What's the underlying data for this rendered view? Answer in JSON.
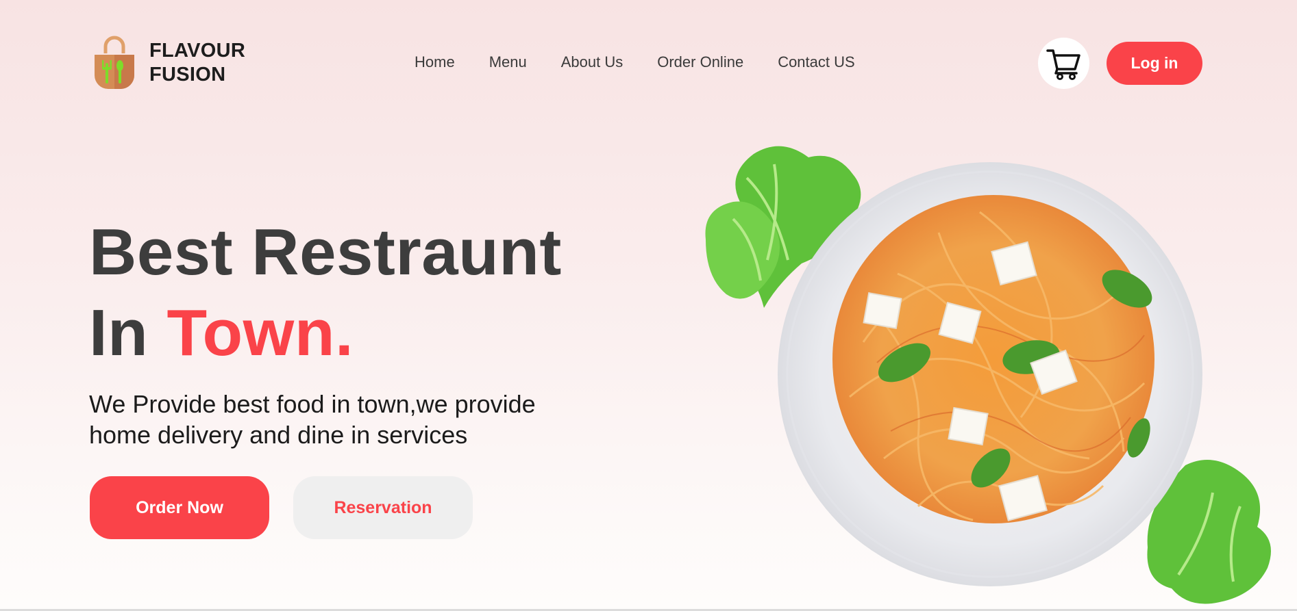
{
  "brand": {
    "line1": "FLAVOUR",
    "line2": "FUSION",
    "logo_icon": "shopping-bag-fork-spoon-icon"
  },
  "nav": {
    "items": [
      {
        "label": "Home"
      },
      {
        "label": "Menu"
      },
      {
        "label": "About Us"
      },
      {
        "label": "Order Online"
      },
      {
        "label": "Contact US"
      }
    ]
  },
  "header": {
    "cart_icon": "cart-icon",
    "login_label": "Log in"
  },
  "hero": {
    "title_line1": "Best Restraunt",
    "title_line2_prefix": "In ",
    "title_line2_accent": "Town.",
    "subtitle": "We Provide best food in town,we provide home delivery and dine in services",
    "order_label": "Order Now",
    "reserve_label": "Reservation",
    "image": "plate-of-spaghetti-with-basil-and-feta-image"
  },
  "colors": {
    "accent": "#fa4349",
    "text_dark": "#3d3d3d",
    "button_secondary_bg": "#efefef"
  }
}
